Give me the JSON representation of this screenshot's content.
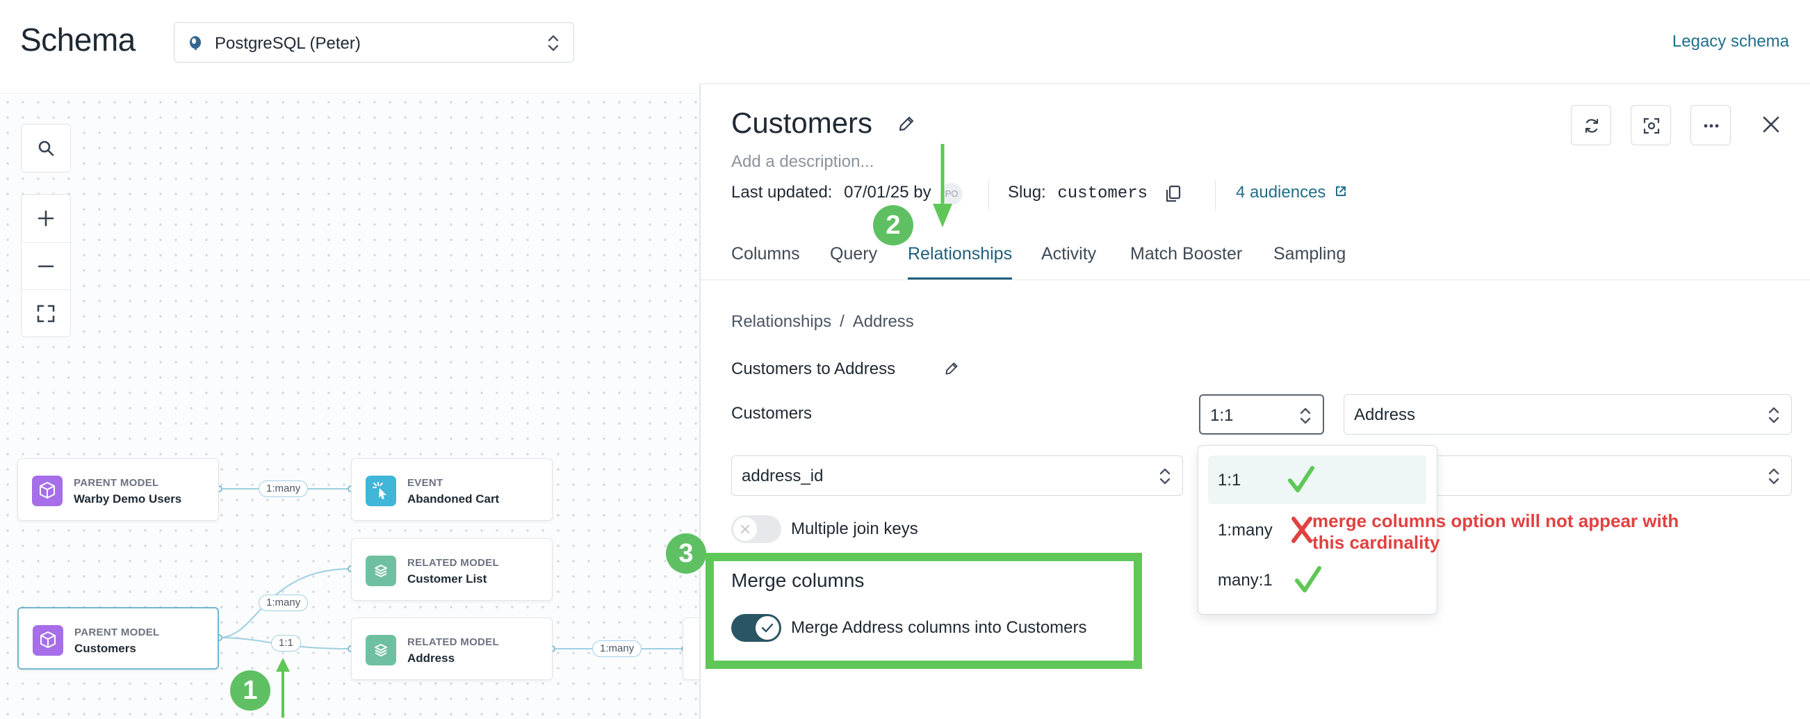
{
  "header": {
    "title": "Schema",
    "source_select": "PostgreSQL (Peter)",
    "legacy_link": "Legacy schema"
  },
  "canvas": {
    "nodes": [
      {
        "type": "PARENT MODEL",
        "name": "Warby Demo Users"
      },
      {
        "type": "EVENT",
        "name": "Abandoned Cart"
      },
      {
        "type": "RELATED MODEL",
        "name": "Customer List"
      },
      {
        "type": "PARENT MODEL",
        "name": "Customers"
      },
      {
        "type": "RELATED MODEL",
        "name": "Address"
      }
    ],
    "edge_labels": [
      "1:many",
      "1:many",
      "1:1",
      "1:many"
    ]
  },
  "annotations": {
    "steps": [
      "1",
      "2",
      "3"
    ],
    "warning": "merge columns option will not appear with this cardinality"
  },
  "panel": {
    "title": "Customers",
    "description_placeholder": "Add a description...",
    "last_updated_label": "Last updated:",
    "last_updated_value": "07/01/25 by",
    "avatar_initials": "PO",
    "slug_label": "Slug:",
    "slug_value": "customers",
    "audiences_link": "4 audiences",
    "tabs": [
      "Columns",
      "Query",
      "Relationships",
      "Activity",
      "Match Booster",
      "Sampling"
    ],
    "active_tab": "Relationships",
    "breadcrumb": {
      "parent": "Relationships",
      "separator": "/",
      "current": "Address"
    },
    "relationship_name": "Customers to Address",
    "from_model": "Customers",
    "cardinality": "1:1",
    "to_model": "Address",
    "from_column": "address_id",
    "multiple_join_keys_label": "Multiple join keys",
    "multiple_join_keys_on": false,
    "merge_columns_title": "Merge columns",
    "merge_columns_toggle_label": "Merge Address columns into Customers",
    "merge_columns_on": true
  },
  "cardinality_dropdown": {
    "options": [
      "1:1",
      "1:many",
      "many:1"
    ],
    "selected": "1:1",
    "marks": [
      "check",
      "cross",
      "check"
    ]
  },
  "colors": {
    "accent": "#1f5f7a",
    "annotation_green": "#5fc757",
    "annotation_red": "#e14141"
  }
}
